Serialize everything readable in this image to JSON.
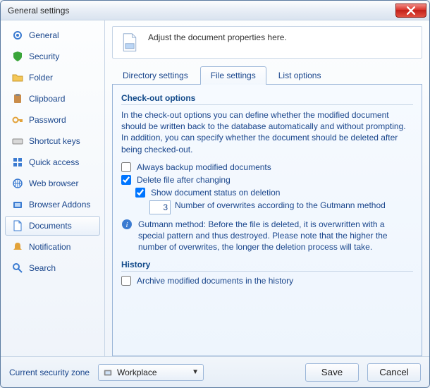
{
  "window": {
    "title": "General settings"
  },
  "sidebar": {
    "items": [
      {
        "label": "General",
        "icon": "gear-icon",
        "selected": false
      },
      {
        "label": "Security",
        "icon": "shield-icon",
        "selected": false
      },
      {
        "label": "Folder",
        "icon": "folder-icon",
        "selected": false
      },
      {
        "label": "Clipboard",
        "icon": "clipboard-icon",
        "selected": false
      },
      {
        "label": "Password",
        "icon": "key-icon",
        "selected": false
      },
      {
        "label": "Shortcut keys",
        "icon": "keyboard-icon",
        "selected": false
      },
      {
        "label": "Quick access",
        "icon": "quick-icon",
        "selected": false
      },
      {
        "label": "Web browser",
        "icon": "globe-icon",
        "selected": false
      },
      {
        "label": "Browser Addons",
        "icon": "addons-icon",
        "selected": false
      },
      {
        "label": "Documents",
        "icon": "document-icon",
        "selected": true
      },
      {
        "label": "Notification",
        "icon": "bell-icon",
        "selected": false
      },
      {
        "label": "Search",
        "icon": "search-icon",
        "selected": false
      }
    ]
  },
  "banner": {
    "text": "Adjust the document properties here."
  },
  "tabs": [
    {
      "label": "Directory settings",
      "active": false
    },
    {
      "label": "File settings",
      "active": true
    },
    {
      "label": "List options",
      "active": false
    }
  ],
  "panel": {
    "checkout": {
      "title": "Check-out options",
      "desc": "In the check-out options you can define whether the modified document should be written back to the database automatically and without prompting. In addition, you can specify whether the document should be deleted after being checked-out.",
      "backup": {
        "label": "Always backup modified documents",
        "checked": false
      },
      "deleteAfter": {
        "label": "Delete file after changing",
        "checked": true
      },
      "showStatus": {
        "label": "Show document status on deletion",
        "checked": true
      },
      "overwrites": {
        "value": "3",
        "label": "Number of overwrites according to the Gutmann method"
      },
      "gutmannNote": "Gutmann method: Before the file is deleted, it is overwritten with a special pattern and thus destroyed. Please note that the higher the number of overwrites, the longer the deletion process will take."
    },
    "history": {
      "title": "History",
      "archive": {
        "label": "Archive modified documents in the history",
        "checked": false
      }
    }
  },
  "footer": {
    "zoneLabel": "Current security zone",
    "zoneValue": "Workplace",
    "save": "Save",
    "cancel": "Cancel"
  },
  "colors": {
    "accent": "#1a468c",
    "border": "#9bb6d8"
  }
}
